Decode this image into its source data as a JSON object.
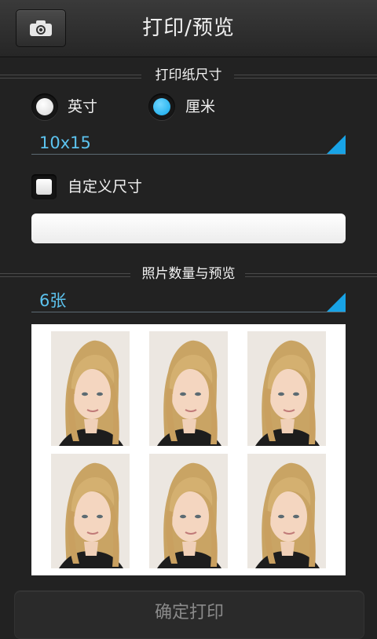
{
  "header": {
    "title": "打印/预览",
    "camera_icon": "camera-icon"
  },
  "paper_size": {
    "section_label": "打印纸尺寸",
    "unit_options": [
      {
        "label": "英寸",
        "selected": false
      },
      {
        "label": "厘米",
        "selected": true
      }
    ],
    "size_value": "10x15",
    "custom_size_label": "自定义尺寸",
    "custom_size_checked": false,
    "custom_size_input_value": ""
  },
  "photos": {
    "section_label": "照片数量与预览",
    "count_value": "6张",
    "preview_count": 6
  },
  "actions": {
    "confirm_label": "确定打印"
  },
  "colors": {
    "accent": "#18a3e6",
    "background": "#222222"
  }
}
